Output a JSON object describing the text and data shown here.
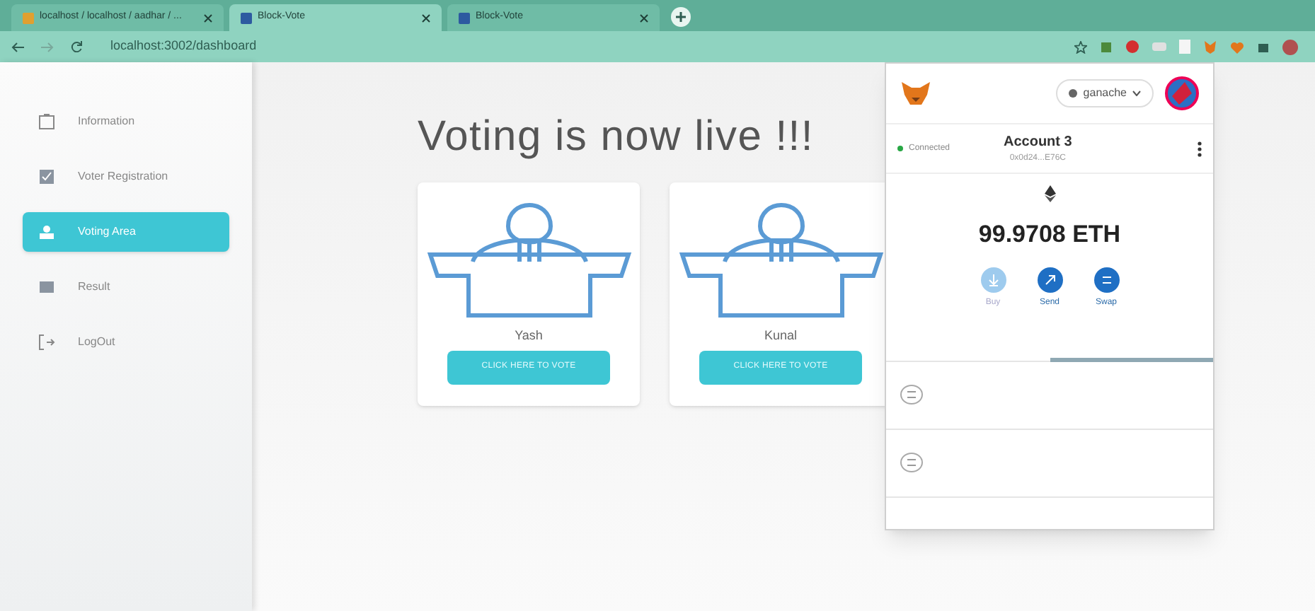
{
  "browser_tabs": [
    {
      "title": "localhost / localhost / aadhar / ...",
      "selected": false
    },
    {
      "title": "Block-Vote",
      "selected": true
    },
    {
      "title": "Block-Vote",
      "selected": false
    }
  ],
  "address_bar": {
    "url": "localhost:3002/dashboard"
  },
  "sidebar": {
    "items": [
      {
        "label": "Information",
        "selected": false
      },
      {
        "label": "Voter Registration",
        "selected": false
      },
      {
        "label": "Voting Area",
        "selected": true
      },
      {
        "label": "Result",
        "selected": false
      },
      {
        "label": "LogOut",
        "selected": false
      }
    ]
  },
  "heading": "Voting is now live !!!",
  "candidates": [
    {
      "name": "Yash",
      "button": "CLICK HERE TO VOTE"
    },
    {
      "name": "Kunal",
      "button": "CLICK HERE TO VOTE"
    }
  ],
  "wallet": {
    "network": "ganache",
    "status": "Connected",
    "account": "Account 3",
    "address": "0x0d24...E76C",
    "balance": "99.9708 ETH",
    "actions": [
      {
        "label": "Buy",
        "disabled": true
      },
      {
        "label": "Send",
        "disabled": false
      },
      {
        "label": "Swap",
        "disabled": false
      }
    ],
    "tabs": [
      {
        "selected": false
      },
      {
        "selected": true
      }
    ],
    "rows": [
      {
        "kind": "activity"
      },
      {
        "kind": "activity"
      }
    ]
  }
}
